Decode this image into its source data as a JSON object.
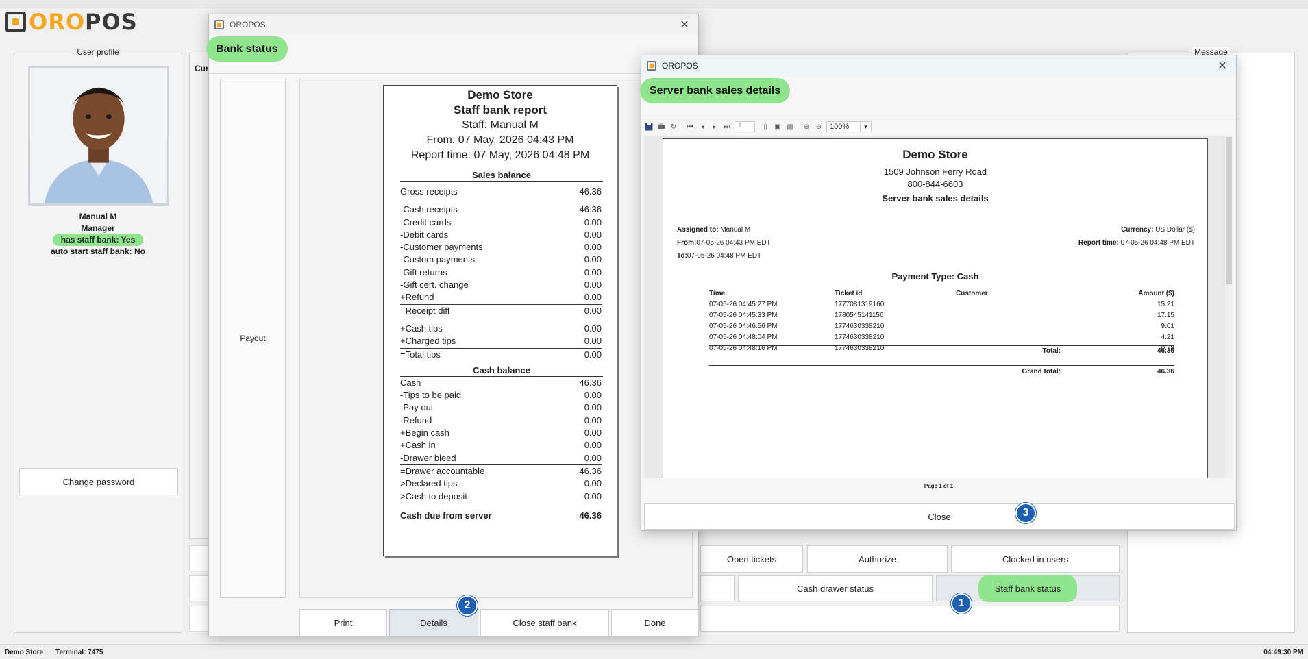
{
  "app": {
    "logo_oro": "ORO",
    "logo_pos": "POS"
  },
  "user_profile": {
    "title": "User profile",
    "name": "Manual M",
    "role": "Manager",
    "has_staff_bank": "has staff bank: Yes",
    "auto_start": "auto start staff bank: No",
    "change_password": "Change password"
  },
  "mid_partial_label": "Cur",
  "message_panel": {
    "title": "Message"
  },
  "actions": {
    "open_tickets": "Open tickets",
    "authorize": "Authorize",
    "clocked_in_users": "Clocked in users",
    "cash_drawer_status": "Cash drawer status",
    "staff_bank_status": "Staff bank status"
  },
  "status_bar": {
    "store": "Demo Store",
    "terminal": "Terminal: 7475",
    "time": "04:49:30 PM"
  },
  "bank_dialog": {
    "window_title": "OROPOS",
    "header": "Bank status",
    "payout": "Payout",
    "buttons": {
      "print": "Print",
      "details": "Details",
      "close_staff_bank": "Close staff bank",
      "done": "Done"
    },
    "report": {
      "store": "Demo Store",
      "title": "Staff bank report",
      "staff": "Staff: Manual M",
      "from": "From: 07 May, 2026 04:43 PM",
      "report_time": "Report time: 07 May, 2026 04:48 PM",
      "sales_balance_title": "Sales balance",
      "gross": {
        "label": "Gross receipts",
        "value": "46.36"
      },
      "sales_rows": [
        {
          "label": "-Cash receipts",
          "value": "46.36"
        },
        {
          "label": "-Credit cards",
          "value": "0.00"
        },
        {
          "label": "-Debit cards",
          "value": "0.00"
        },
        {
          "label": "-Customer payments",
          "value": "0.00"
        },
        {
          "label": "-Custom payments",
          "value": "0.00"
        },
        {
          "label": "-Gift returns",
          "value": "0.00"
        },
        {
          "label": "-Gift cert. change",
          "value": "0.00"
        },
        {
          "label": "+Refund",
          "value": "0.00"
        }
      ],
      "receipt_diff": {
        "label": "=Receipt diff",
        "value": "0.00"
      },
      "tips_rows": [
        {
          "label": "+Cash tips",
          "value": "0.00"
        },
        {
          "label": "+Charged tips",
          "value": "0.00"
        }
      ],
      "total_tips": {
        "label": "=Total tips",
        "value": "0.00"
      },
      "cash_balance_title": "Cash balance",
      "cash_rows": [
        {
          "label": "Cash",
          "value": "46.36"
        },
        {
          "label": "-Tips to be paid",
          "value": "0.00"
        },
        {
          "label": "-Pay out",
          "value": "0.00"
        },
        {
          "label": "-Refund",
          "value": "0.00"
        },
        {
          "label": "+Begin cash",
          "value": "0.00"
        },
        {
          "label": "+Cash in",
          "value": "0.00"
        },
        {
          "label": "-Drawer bleed",
          "value": "0.00"
        }
      ],
      "drawer_rows": [
        {
          "label": "=Drawer accountable",
          "value": "46.36"
        },
        {
          "label": ">Declared tips",
          "value": "0.00"
        },
        {
          "label": ">Cash to deposit",
          "value": "0.00"
        }
      ],
      "cash_due": {
        "label": "Cash due from server",
        "value": "46.36"
      }
    }
  },
  "server_dialog": {
    "window_title": "OROPOS",
    "header": "Server bank sales details",
    "toolbar": {
      "page_input": "1",
      "zoom": "100%"
    },
    "page": {
      "store": "Demo Store",
      "address": "1509 Johnson Ferry Road",
      "phone": "800-844-6603",
      "heading": "Server bank sales details",
      "assigned_label": "Assigned to:",
      "assigned_value": "Manual M",
      "from_label": "From:",
      "from_value": "07-05-26 04:43 PM EDT",
      "to_label": "To:",
      "to_value": "07-05-26 04:48 PM EDT",
      "currency_label": "Currency:",
      "currency_value": "US Dollar ($)",
      "report_time_label": "Report time:",
      "report_time_value": "07-05-26 04:48 PM EDT",
      "payment_type": "Payment Type: Cash",
      "columns": [
        "Time",
        "Ticket id",
        "Customer",
        "Amount ($)"
      ],
      "rows": [
        [
          "07-05-26 04:45:27 PM",
          "1777081319160",
          "",
          "15.21"
        ],
        [
          "07-05-26 04:45:33 PM",
          "1780545141156",
          "",
          "17.15"
        ],
        [
          "07-05-26 04:46:56 PM",
          "1774630338210",
          "",
          "9.01"
        ],
        [
          "07-05-26 04:48:04 PM",
          "1774630338210",
          "",
          "4.21"
        ],
        [
          "07-05-26 04:48:16 PM",
          "1774630338210",
          "",
          "0.78"
        ]
      ],
      "total_label": "Total:",
      "total_value": "46.36",
      "grand_total_label": "Grand total:",
      "grand_total_value": "46.36"
    },
    "page_of": "Page 1 of 1",
    "close": "Close"
  },
  "badges": [
    "1",
    "2",
    "3"
  ]
}
